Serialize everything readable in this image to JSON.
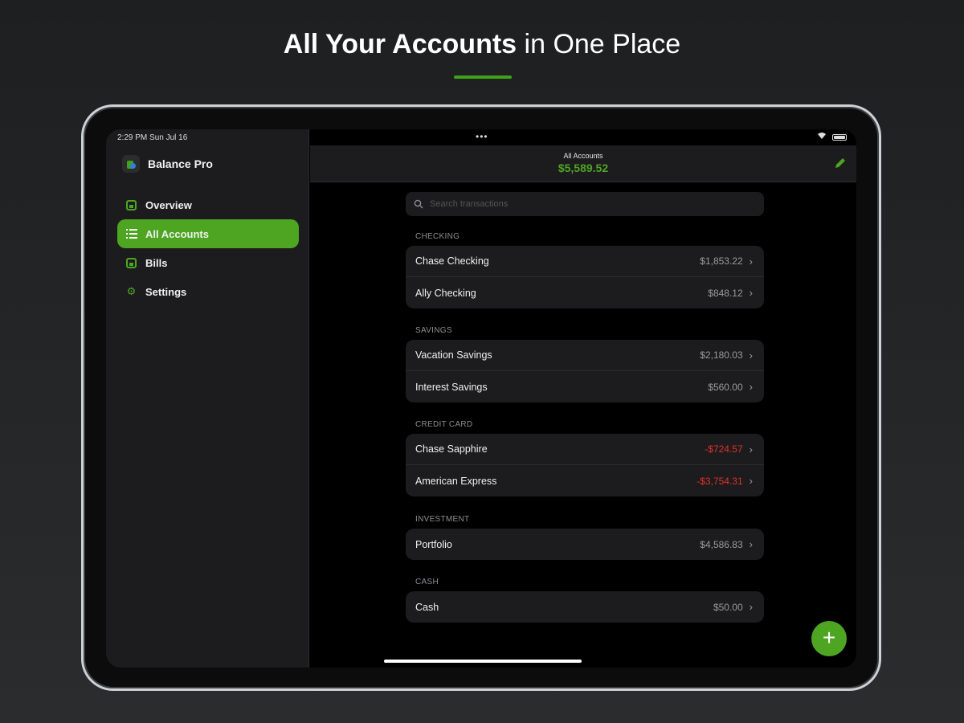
{
  "headline": {
    "bold": "All Your Accounts",
    "light": "in One Place"
  },
  "status_bar": {
    "time": "2:29 PM  Sun Jul 16",
    "dots": "•••"
  },
  "sidebar": {
    "app_name": "Balance Pro",
    "items": [
      {
        "label": "Overview",
        "icon": "chart-icon",
        "active": false
      },
      {
        "label": "All Accounts",
        "icon": "list-icon",
        "active": true
      },
      {
        "label": "Bills",
        "icon": "bill-icon",
        "active": false
      },
      {
        "label": "Settings",
        "icon": "gear-icon",
        "active": false
      }
    ]
  },
  "header": {
    "label": "All Accounts",
    "total": "$5,589.52"
  },
  "search": {
    "placeholder": "Search transactions"
  },
  "sections": [
    {
      "title": "CHECKING",
      "rows": [
        {
          "name": "Chase Checking",
          "amount": "$1,853.22",
          "negative": false
        },
        {
          "name": "Ally Checking",
          "amount": "$848.12",
          "negative": false
        }
      ]
    },
    {
      "title": "SAVINGS",
      "rows": [
        {
          "name": "Vacation Savings",
          "amount": "$2,180.03",
          "negative": false
        },
        {
          "name": "Interest Savings",
          "amount": "$560.00",
          "negative": false
        }
      ]
    },
    {
      "title": "CREDIT CARD",
      "rows": [
        {
          "name": "Chase Sapphire",
          "amount": "-$724.57",
          "negative": true
        },
        {
          "name": "American Express",
          "amount": "-$3,754.31",
          "negative": true
        }
      ]
    },
    {
      "title": "INVESTMENT",
      "rows": [
        {
          "name": "Portfolio",
          "amount": "$4,586.83",
          "negative": false
        }
      ]
    },
    {
      "title": "CASH",
      "rows": [
        {
          "name": "Cash",
          "amount": "$50.00",
          "negative": false
        }
      ]
    }
  ],
  "colors": {
    "accent": "#4da521",
    "negative": "#e0302a",
    "panel": "#1c1c1e"
  }
}
